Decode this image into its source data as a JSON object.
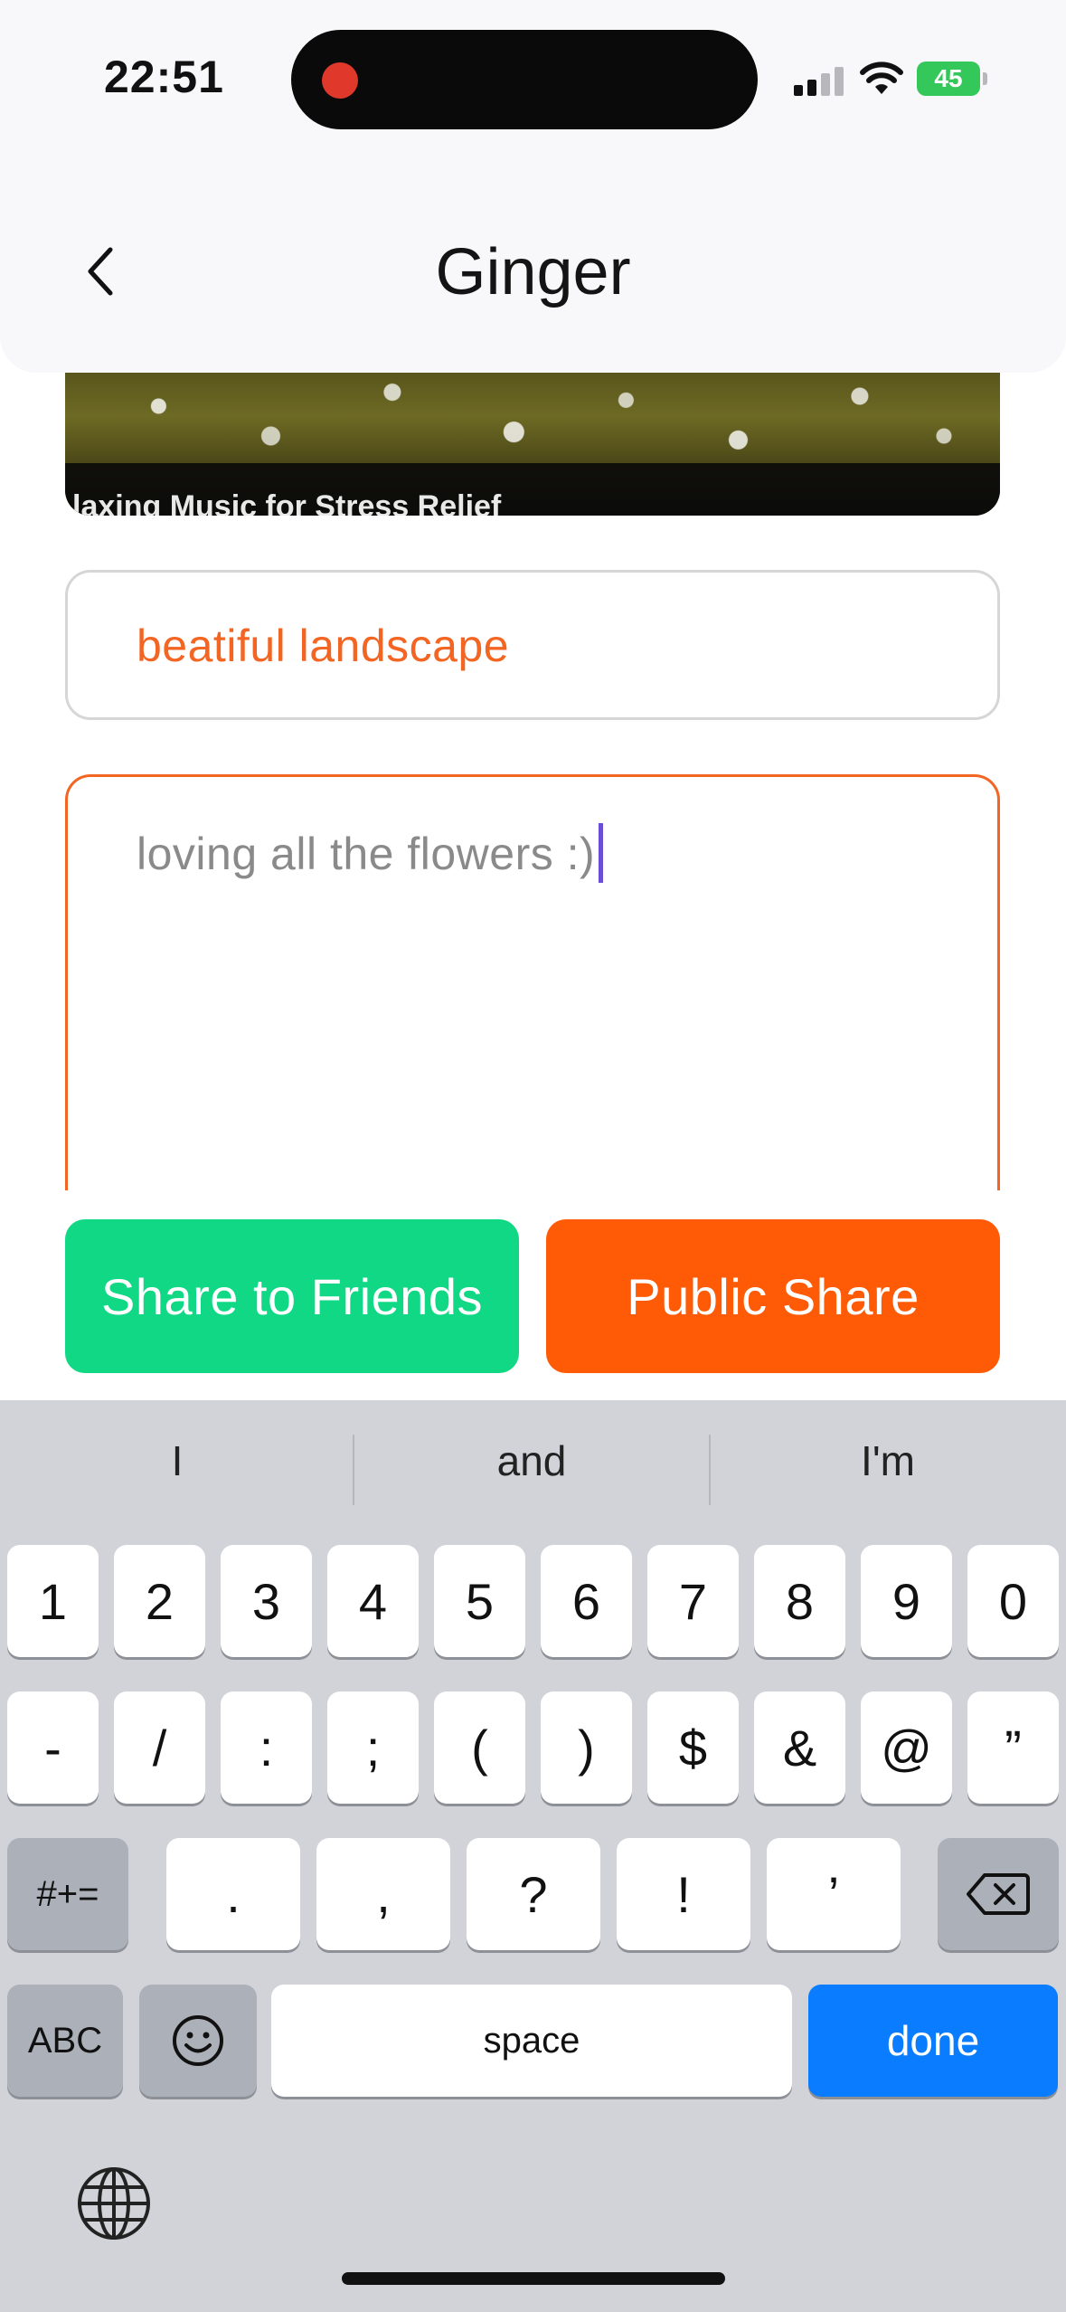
{
  "status_bar": {
    "time": "22:51",
    "battery": "45"
  },
  "header": {
    "title": "Ginger"
  },
  "video": {
    "caption": "laxing Music for Stress Relief"
  },
  "form": {
    "title_value": "beatiful landscape",
    "description_value": "loving all the flowers :)"
  },
  "actions": {
    "share_friends": "Share to Friends",
    "public_share": "Public Share"
  },
  "keyboard": {
    "suggestions": [
      "I",
      "and",
      "I'm"
    ],
    "row1": [
      "1",
      "2",
      "3",
      "4",
      "5",
      "6",
      "7",
      "8",
      "9",
      "0"
    ],
    "row2": [
      "-",
      "/",
      ":",
      ";",
      "(",
      ")",
      "$",
      "&",
      "@",
      "”"
    ],
    "row3": [
      "#+=",
      ".",
      ",",
      "?",
      "!",
      "’"
    ],
    "row4": {
      "abc": "ABC",
      "space": "space",
      "done": "done"
    }
  },
  "colors": {
    "accent": "#f36522",
    "green": "#11d884",
    "orange": "#ff5a05",
    "key_blue": "#0a7cff"
  },
  "icons": [
    "chevron-left-icon",
    "globe-icon",
    "emoji-icon",
    "backspace-icon",
    "wifi-icon",
    "signal-icon",
    "battery-icon"
  ]
}
